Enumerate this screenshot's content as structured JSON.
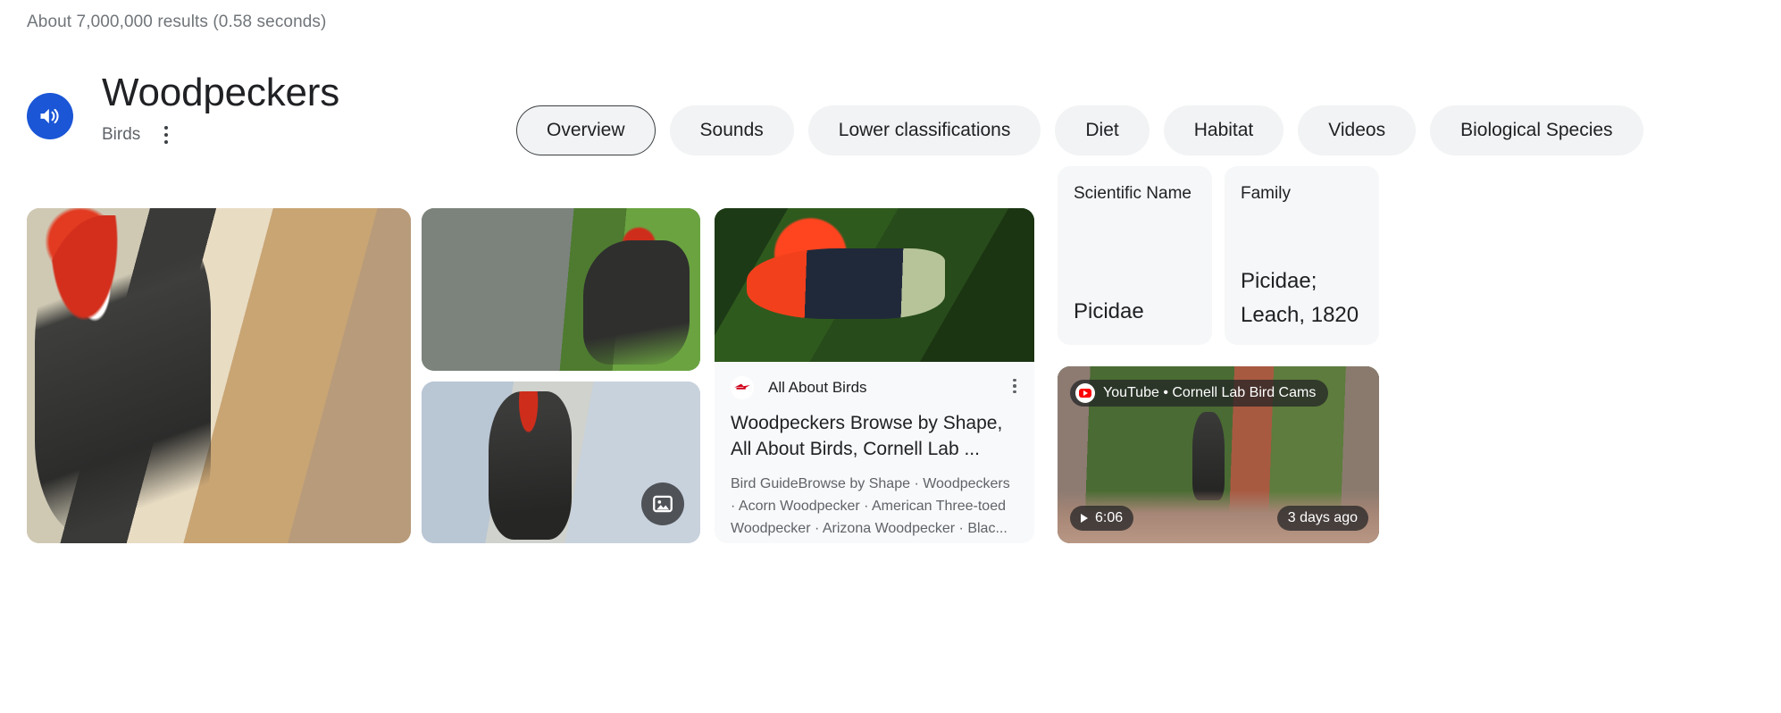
{
  "results_count": "About 7,000,000 results (0.58 seconds)",
  "knowledge_panel": {
    "title": "Woodpeckers",
    "subtitle": "Birds",
    "listen_icon": "speaker-volume-icon",
    "more_icon": "more-options-icon",
    "accent_color": "#1a56d6"
  },
  "tabs": [
    {
      "label": "Overview",
      "selected": true
    },
    {
      "label": "Sounds",
      "selected": false
    },
    {
      "label": "Lower classifications",
      "selected": false
    },
    {
      "label": "Diet",
      "selected": false
    },
    {
      "label": "Habitat",
      "selected": false
    },
    {
      "label": "Videos",
      "selected": false
    },
    {
      "label": "Biological Species",
      "selected": false
    }
  ],
  "media": {
    "hero_alt": "pileated-woodpecker-on-tree-trunk",
    "thumb_top_alt": "pileated-woodpecker-on-nest-hole",
    "thumb_bottom_alt": "pileated-woodpecker-on-birch-trunk",
    "more_images_icon": "image-icon"
  },
  "result_card": {
    "source": "All About Birds",
    "favicon": "all-about-birds-favicon",
    "title": "Woodpeckers Browse by Shape, All About Birds, Cornell Lab ...",
    "description": "Bird GuideBrowse by Shape · Woodpeckers · Acorn Woodpecker · American Three-toed Woodpecker · Arizona Woodpecker · Blac...",
    "thumb_alt": "scarlet-tanager-on-branch",
    "more_icon": "more-options-icon"
  },
  "facts": [
    {
      "label": "Scientific Name",
      "value": "Picidae"
    },
    {
      "label": "Family",
      "value": "Picidae; Leach, 1820"
    }
  ],
  "video_card": {
    "platform": "YouTube",
    "separator": "•",
    "channel": "Cornell Lab Bird Cams",
    "platform_channel": "YouTube • Cornell Lab Bird Cams",
    "duration": "6:06",
    "age": "3 days ago",
    "play_icon": "play-icon",
    "youtube_icon": "youtube-icon",
    "thumb_alt": "woodpecker-at-feeder-bird-cam"
  }
}
